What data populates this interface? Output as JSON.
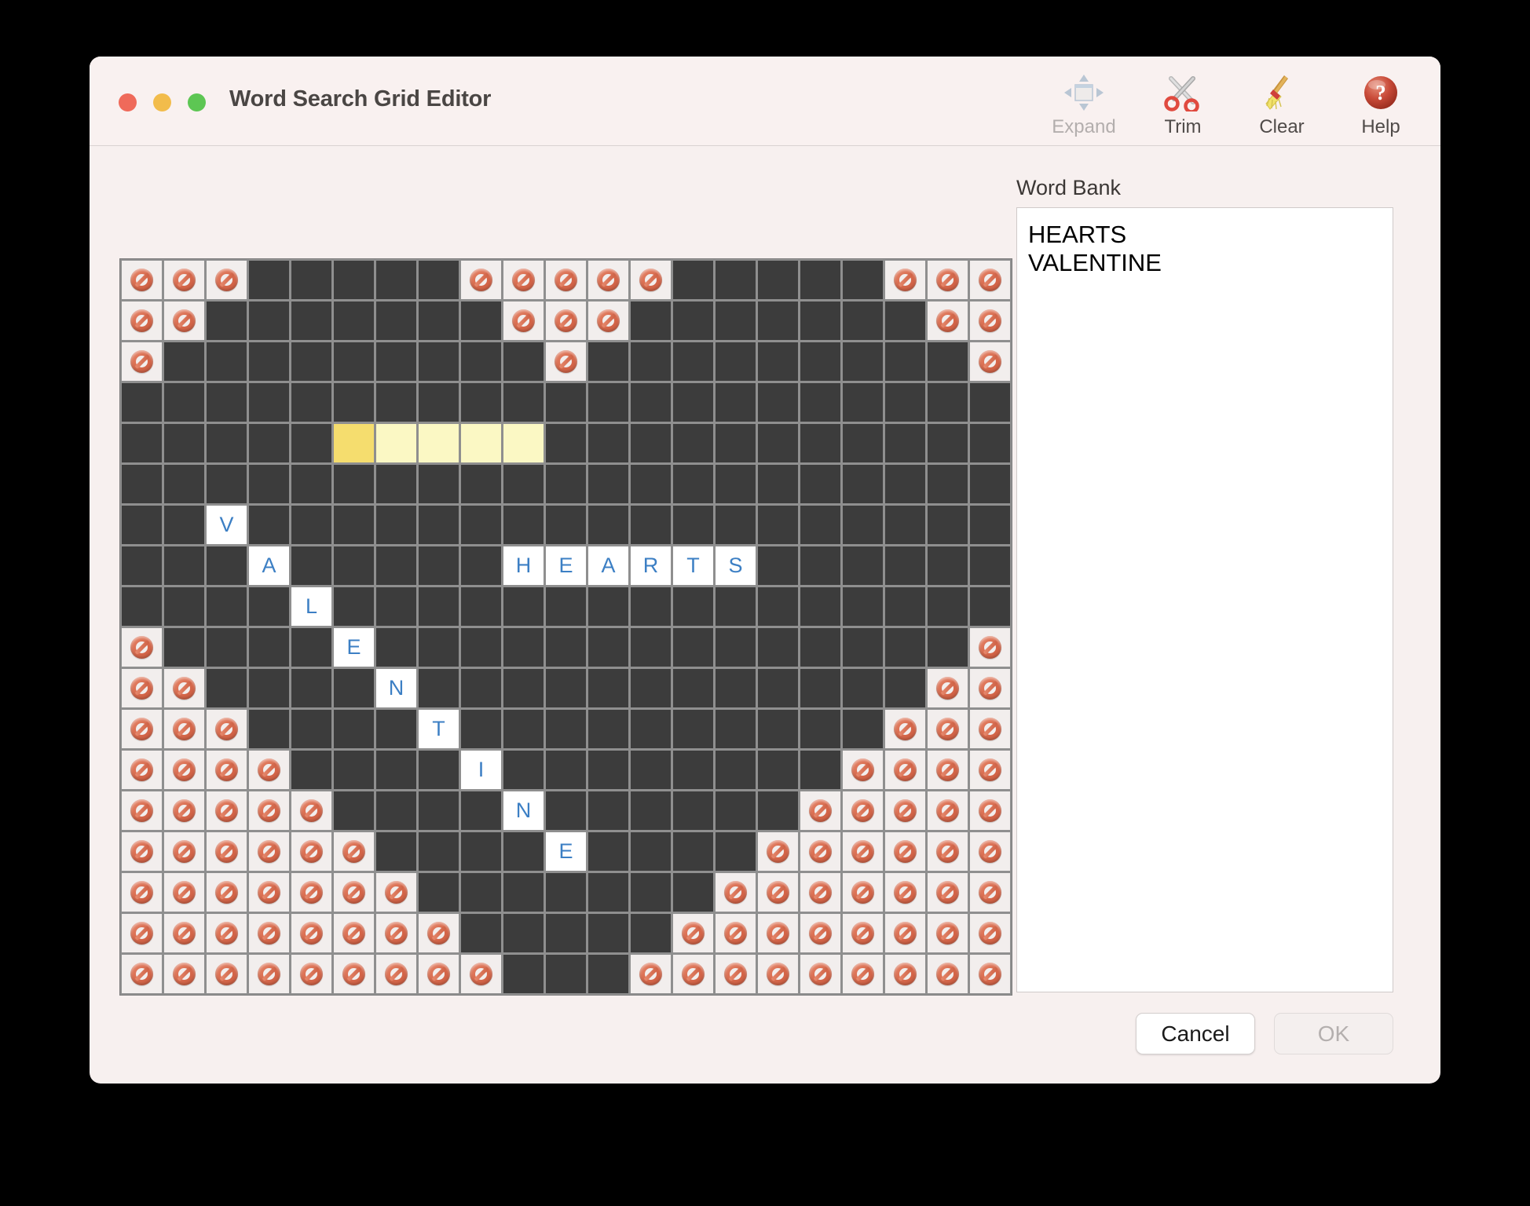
{
  "window": {
    "title": "Word Search Grid Editor",
    "traffic_lights": [
      {
        "name": "close",
        "color": "#ef6a5a"
      },
      {
        "name": "minimize",
        "color": "#f2bc4b"
      },
      {
        "name": "zoom",
        "color": "#5dc653"
      }
    ]
  },
  "toolbar": {
    "items": [
      {
        "label": "Expand",
        "icon": "expand-arrows-icon",
        "enabled": false
      },
      {
        "label": "Trim",
        "icon": "scissors-icon",
        "enabled": true
      },
      {
        "label": "Clear",
        "icon": "broom-icon",
        "enabled": true
      },
      {
        "label": "Help",
        "icon": "question-mark-icon",
        "enabled": true
      }
    ]
  },
  "word_bank": {
    "label": "Word Bank",
    "words": [
      "HEARTS",
      "VALENTINE"
    ]
  },
  "footer": {
    "cancel_label": "Cancel",
    "ok_label": "OK",
    "ok_enabled": false
  },
  "colors": {
    "cell_open": "#3c3c3c",
    "cell_blocked": "#f2eeed",
    "cell_letter_bg": "#ffffff",
    "letter_text": "#3c7fc4",
    "selection_anchor": "#f5dd6e",
    "selection_fill": "#fbf8c4",
    "grid_line": "#8f8f8f",
    "window_bg": "#f7f0ef"
  },
  "grid": {
    "rows": 18,
    "cols": 21,
    "legend": {
      "o": "open (dark, placeable)",
      "x": "blocked (no-entry icon)",
      "A": "gold selection anchor",
      "s": "light selection fill"
    },
    "cells": [
      "xxxooooo xxxxx ooooo xxx",
      "xxooooooo xxx ooooooo xx",
      "xooooooooo x ooooooooo x",
      "ooooooooooooooooooooo",
      "oooooAssssooooooooooo",
      "ooooooooooooooooooooo",
      "ooVoooooooooooooooooo",
      "oooAooooooHEARTSooooo",
      "ooooLoooooooooooooooo",
      "xoooo E oooooooooooo x",
      "xxoooo N oooooooooo xx",
      "xxxooo T oooooooo xxx",
      "xxxxoo I oooooo xxxx",
      "xxxxxo N oooo xxxxx",
      "xxxxxx E oo xxxxxx",
      "xxxxxxxooooooxxxxxxxx",
      "xxxxxxxxooooo xxxxxxxx",
      "xxxxxxxxxooo xxxxxxxxx"
    ],
    "rows_data": [
      {
        "r": 0,
        "blocked": [
          0,
          1,
          2,
          8,
          9,
          10,
          11,
          12,
          18,
          19,
          20
        ],
        "letters": {},
        "selection": []
      },
      {
        "r": 1,
        "blocked": [
          0,
          1,
          9,
          10,
          11,
          19,
          20
        ],
        "letters": {},
        "selection": []
      },
      {
        "r": 2,
        "blocked": [
          0,
          10,
          20
        ],
        "letters": {},
        "selection": []
      },
      {
        "r": 3,
        "blocked": [],
        "letters": {},
        "selection": []
      },
      {
        "r": 4,
        "blocked": [],
        "letters": {},
        "selection": [
          5,
          6,
          7,
          8,
          9
        ],
        "anchor": 5
      },
      {
        "r": 5,
        "blocked": [],
        "letters": {},
        "selection": []
      },
      {
        "r": 6,
        "blocked": [],
        "letters": {
          "2": "V"
        },
        "selection": []
      },
      {
        "r": 7,
        "blocked": [],
        "letters": {
          "3": "A",
          "9": "H",
          "10": "E",
          "11": "A",
          "12": "R",
          "13": "T",
          "14": "S"
        },
        "selection": []
      },
      {
        "r": 8,
        "blocked": [],
        "letters": {
          "4": "L"
        },
        "selection": []
      },
      {
        "r": 9,
        "blocked": [
          0,
          20
        ],
        "letters": {
          "5": "E"
        },
        "selection": []
      },
      {
        "r": 10,
        "blocked": [
          0,
          1,
          19,
          20
        ],
        "letters": {
          "6": "N"
        },
        "selection": []
      },
      {
        "r": 11,
        "blocked": [
          0,
          1,
          2,
          18,
          19,
          20
        ],
        "letters": {
          "7": "T"
        },
        "selection": []
      },
      {
        "r": 12,
        "blocked": [
          0,
          1,
          2,
          3,
          17,
          18,
          19,
          20
        ],
        "letters": {
          "8": "I"
        },
        "selection": []
      },
      {
        "r": 13,
        "blocked": [
          0,
          1,
          2,
          3,
          4,
          16,
          17,
          18,
          19,
          20
        ],
        "letters": {
          "9": "N"
        },
        "selection": []
      },
      {
        "r": 14,
        "blocked": [
          0,
          1,
          2,
          3,
          4,
          5,
          15,
          16,
          17,
          18,
          19,
          20
        ],
        "letters": {
          "10": "E"
        },
        "selection": []
      },
      {
        "r": 15,
        "blocked": [
          0,
          1,
          2,
          3,
          4,
          5,
          6,
          14,
          15,
          16,
          17,
          18,
          19,
          20
        ],
        "letters": {},
        "selection": []
      },
      {
        "r": 16,
        "blocked": [
          0,
          1,
          2,
          3,
          4,
          5,
          6,
          7,
          13,
          14,
          15,
          16,
          17,
          18,
          19,
          20
        ],
        "letters": {},
        "selection": []
      },
      {
        "r": 17,
        "blocked": [
          0,
          1,
          2,
          3,
          4,
          5,
          6,
          7,
          8,
          12,
          13,
          14,
          15,
          16,
          17,
          18,
          19,
          20
        ],
        "letters": {},
        "selection": []
      }
    ]
  }
}
